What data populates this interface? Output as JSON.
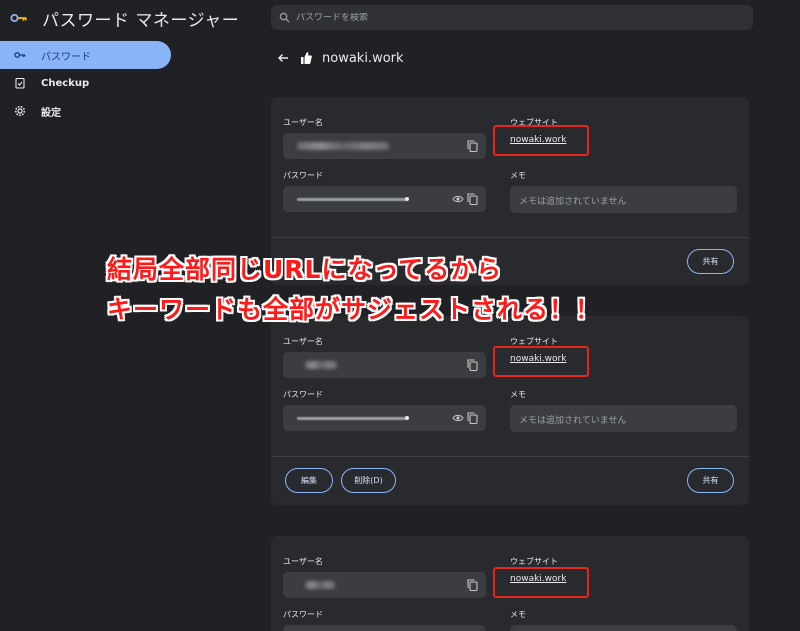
{
  "app": {
    "title": "パスワード マネージャー",
    "logo_icon": "key-icon"
  },
  "search": {
    "placeholder": "パスワードを検索"
  },
  "sidebar": {
    "items": [
      {
        "label": "パスワード",
        "icon": "key-icon",
        "active": true
      },
      {
        "label": "Checkup",
        "icon": "clipboard-check-icon",
        "active": false
      },
      {
        "label": "設定",
        "icon": "gear-icon",
        "active": false
      }
    ]
  },
  "site": {
    "title": "nowaki.work",
    "back_icon": "arrow-left-icon",
    "favicon": "thumbs-up-icon"
  },
  "labels": {
    "username": "ユーザー名",
    "website": "ウェブサイト",
    "password": "パスワード",
    "memo": "メモ",
    "memo_placeholder": "メモは追加されていません",
    "edit": "編集",
    "delete": "削除(D)",
    "share": "共有"
  },
  "cards": [
    {
      "website": "nowaki.work"
    },
    {
      "website": "nowaki.work"
    },
    {
      "website": "nowaki.work"
    }
  ],
  "annotation": {
    "line1": "結局全部同じURLになってるから",
    "line2": "キーワードも全部がサジェストされる！！",
    "color": "#ff1a1a"
  },
  "colors": {
    "accent": "#8ab4f8",
    "background": "#202124",
    "card": "#292a2d",
    "highlight_box": "#e5261b"
  }
}
